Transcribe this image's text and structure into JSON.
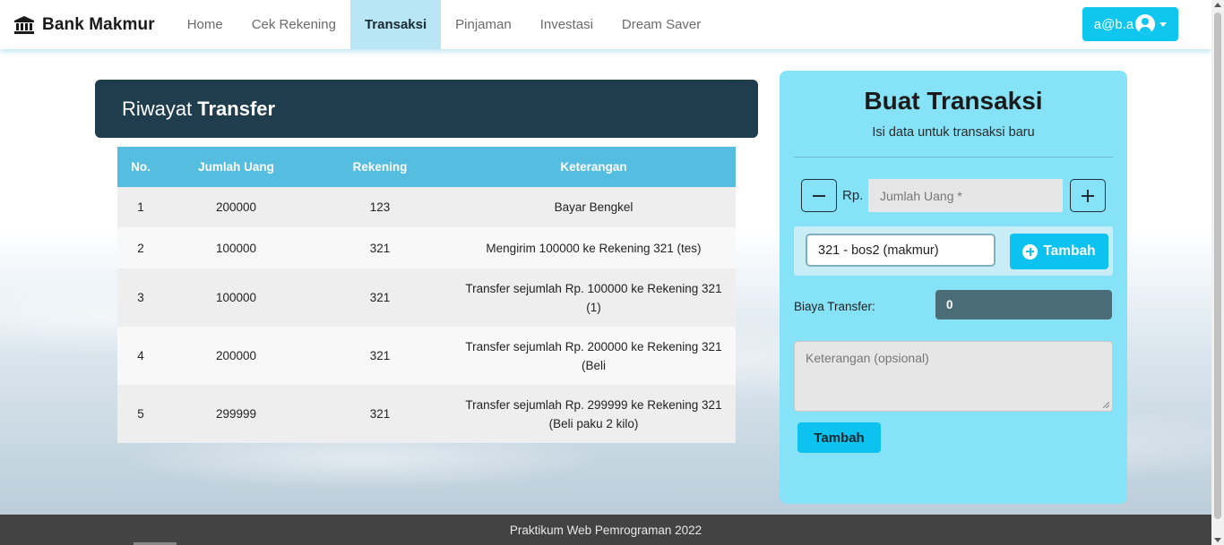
{
  "brand": {
    "name": "Bank Makmur",
    "icon": "bank-icon"
  },
  "nav": {
    "items": [
      {
        "label": "Home",
        "active": false
      },
      {
        "label": "Cek Rekening",
        "active": false
      },
      {
        "label": "Transaksi",
        "active": true
      },
      {
        "label": "Pinjaman",
        "active": false
      },
      {
        "label": "Investasi",
        "active": false
      },
      {
        "label": "Dream Saver",
        "active": false
      }
    ],
    "user": {
      "email": "a@b.a",
      "icon": "user-circle-icon"
    }
  },
  "history": {
    "title_light": "Riwayat",
    "title_bold": "Transfer",
    "columns": [
      "No.",
      "Jumlah Uang",
      "Rekening",
      "Keterangan"
    ],
    "rows": [
      {
        "no": "1",
        "amount": "200000",
        "account": "123",
        "note": "Bayar Bengkel"
      },
      {
        "no": "2",
        "amount": "100000",
        "account": "321",
        "note": "Mengirim 100000 ke Rekening 321 (tes)"
      },
      {
        "no": "3",
        "amount": "100000",
        "account": "321",
        "note": "Transfer sejumlah Rp. 100000 ke Rekening 321 (1)"
      },
      {
        "no": "4",
        "amount": "200000",
        "account": "321",
        "note": "Transfer sejumlah Rp. 200000 ke Rekening 321 (Beli"
      },
      {
        "no": "5",
        "amount": "299999",
        "account": "321",
        "note": "Transfer sejumlah Rp. 299999 ke Rekening 321 (Beli paku 2 kilo)"
      }
    ]
  },
  "form": {
    "title": "Buat Transaksi",
    "subtitle": "Isi data untuk transaksi baru",
    "currency_label": "Rp.",
    "amount_placeholder": "Jumlah Uang *",
    "account_selected": "321 - bos2 (makmur)",
    "add_account_label": "Tambah",
    "fee_label": "Biaya Transfer:",
    "fee_value": "0",
    "note_placeholder": "Keterangan (opsional)",
    "submit_label": "Tambah"
  },
  "footer": {
    "text": "Praktikum Web Pemrograman 2022"
  },
  "colors": {
    "accent": "#0fc6ee",
    "nav_active_bg": "#b8e6f4",
    "history_header_bg": "#1f3d4d",
    "table_header_bg": "#54bde0",
    "form_card_bg": "#86e2f7",
    "fee_bg": "#4a6d78",
    "footer_bg": "#434343"
  }
}
